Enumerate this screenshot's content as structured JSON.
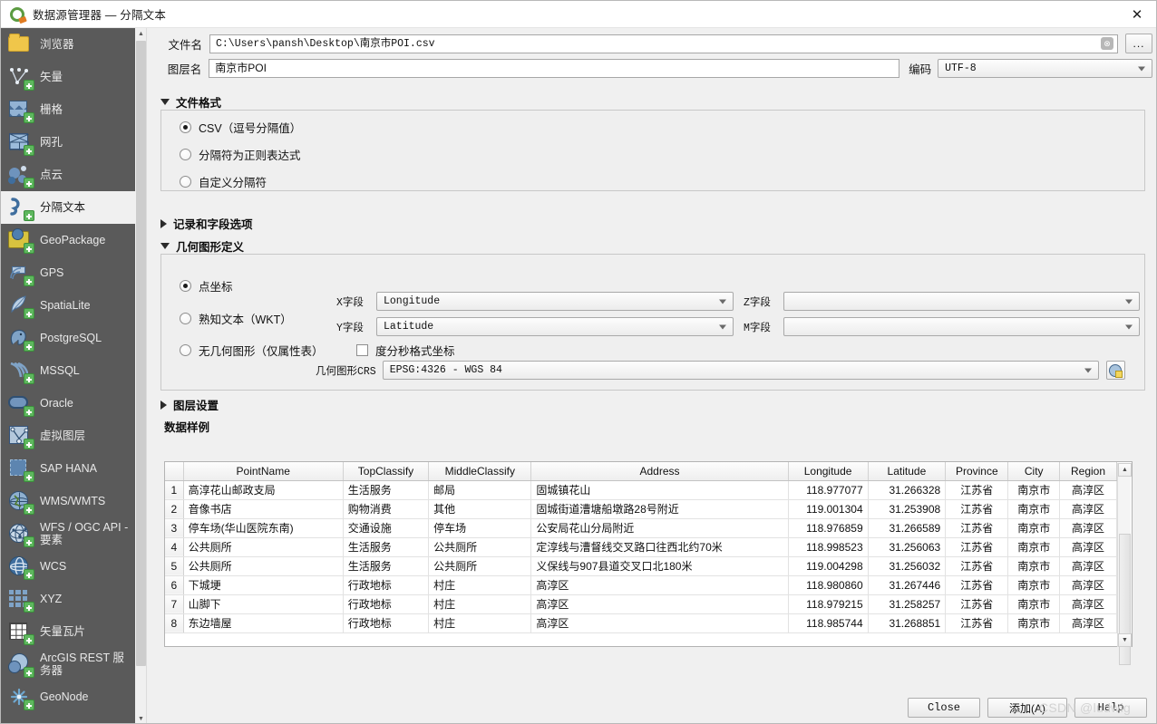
{
  "window": {
    "title": "数据源管理器 — 分隔文本",
    "app_icon": "qgis-logo-icon",
    "close_label": "✕"
  },
  "sidebar": {
    "items": [
      {
        "label": "浏览器",
        "icon": "folder-icon",
        "selected": false
      },
      {
        "label": "矢量",
        "icon": "vector-icon",
        "selected": false
      },
      {
        "label": "栅格",
        "icon": "raster-icon",
        "selected": false
      },
      {
        "label": "网孔",
        "icon": "mesh-icon",
        "selected": false
      },
      {
        "label": "点云",
        "icon": "point-cloud-icon",
        "selected": false
      },
      {
        "label": "分隔文本",
        "icon": "delimited-text-icon",
        "selected": true
      },
      {
        "label": "GeoPackage",
        "icon": "geopackage-icon",
        "selected": false
      },
      {
        "label": "GPS",
        "icon": "gps-icon",
        "selected": false
      },
      {
        "label": "SpatiaLite",
        "icon": "spatialite-icon",
        "selected": false
      },
      {
        "label": "PostgreSQL",
        "icon": "postgresql-icon",
        "selected": false
      },
      {
        "label": "MSSQL",
        "icon": "mssql-icon",
        "selected": false
      },
      {
        "label": "Oracle",
        "icon": "oracle-icon",
        "selected": false
      },
      {
        "label": "虚拟图层",
        "icon": "virtual-layer-icon",
        "selected": false
      },
      {
        "label": "SAP HANA",
        "icon": "sap-hana-icon",
        "selected": false
      },
      {
        "label": "WMS/WMTS",
        "icon": "wms-icon",
        "selected": false
      },
      {
        "label": "WFS / OGC API - 要素",
        "icon": "wfs-icon",
        "selected": false
      },
      {
        "label": "WCS",
        "icon": "wcs-icon",
        "selected": false
      },
      {
        "label": "XYZ",
        "icon": "xyz-icon",
        "selected": false
      },
      {
        "label": "矢量瓦片",
        "icon": "vector-tile-icon",
        "selected": false
      },
      {
        "label": "ArcGIS REST 服务器",
        "icon": "arcgis-rest-icon",
        "selected": false
      },
      {
        "label": "GeoNode",
        "icon": "geonode-icon",
        "selected": false
      }
    ]
  },
  "form": {
    "filename_label": "文件名",
    "filename_value": "C:\\Users\\pansh\\Desktop\\南京市POI.csv",
    "filename_clear": "⊗",
    "browse_label": "...",
    "layername_label": "图层名",
    "layername_value": "南京市POI",
    "encoding_label": "编码",
    "encoding_value": "UTF-8"
  },
  "file_format": {
    "title": "文件格式",
    "expanded": true,
    "options": [
      {
        "label": "CSV（逗号分隔值）",
        "selected": true
      },
      {
        "label": "分隔符为正则表达式",
        "selected": false
      },
      {
        "label": "自定义分隔符",
        "selected": false
      }
    ]
  },
  "record_field_options": {
    "title": "记录和字段选项",
    "expanded": false
  },
  "geometry": {
    "title": "几何图形定义",
    "expanded": true,
    "options": [
      {
        "label": "点坐标",
        "selected": true
      },
      {
        "label": "熟知文本（WKT）",
        "selected": false
      },
      {
        "label": "无几何图形（仅属性表）",
        "selected": false
      }
    ],
    "x_field_label": "X字段",
    "x_field_value": "Longitude",
    "y_field_label": "Y字段",
    "y_field_value": "Latitude",
    "z_field_label": "Z字段",
    "z_field_value": "",
    "m_field_label": "M字段",
    "m_field_value": "",
    "dms_label": "度分秒格式坐标",
    "dms_checked": false,
    "crs_label": "几何图形CRS",
    "crs_value": "EPSG:4326 - WGS 84",
    "crs_select_icon": "crs-picker-icon"
  },
  "layer_settings": {
    "title": "图层设置",
    "expanded": false
  },
  "sample_data": {
    "title": "数据样例",
    "columns": [
      "PointName",
      "TopClassify",
      "MiddleClassify",
      "Address",
      "Longitude",
      "Latitude",
      "Province",
      "City",
      "Region"
    ],
    "rows": [
      {
        "n": "1",
        "cells": [
          "高淳花山邮政支局",
          "生活服务",
          "邮局",
          "固城镇花山",
          "118.977077",
          "31.266328",
          "江苏省",
          "南京市",
          "高淳区"
        ]
      },
      {
        "n": "2",
        "cells": [
          "音像书店",
          "购物消费",
          "其他",
          "固城街道漕塘船墩路28号附近",
          "119.001304",
          "31.253908",
          "江苏省",
          "南京市",
          "高淳区"
        ]
      },
      {
        "n": "3",
        "cells": [
          "停车场(华山医院东南)",
          "交通设施",
          "停车场",
          "公安局花山分局附近",
          "118.976859",
          "31.266589",
          "江苏省",
          "南京市",
          "高淳区"
        ]
      },
      {
        "n": "4",
        "cells": [
          "公共厕所",
          "生活服务",
          "公共厕所",
          "定淳线与漕督线交叉路口往西北约70米",
          "118.998523",
          "31.256063",
          "江苏省",
          "南京市",
          "高淳区"
        ]
      },
      {
        "n": "5",
        "cells": [
          "公共厕所",
          "生活服务",
          "公共厕所",
          "义保线与907县道交叉口北180米",
          "119.004298",
          "31.256032",
          "江苏省",
          "南京市",
          "高淳区"
        ]
      },
      {
        "n": "6",
        "cells": [
          "下城埂",
          "行政地标",
          "村庄",
          "高淳区",
          "118.980860",
          "31.267446",
          "江苏省",
          "南京市",
          "高淳区"
        ]
      },
      {
        "n": "7",
        "cells": [
          "山脚下",
          "行政地标",
          "村庄",
          "高淳区",
          "118.979215",
          "31.258257",
          "江苏省",
          "南京市",
          "高淳区"
        ]
      },
      {
        "n": "8",
        "cells": [
          "东边墙屋",
          "行政地标",
          "村庄",
          "高淳区",
          "118.985744",
          "31.268851",
          "江苏省",
          "南京市",
          "高淳区"
        ]
      }
    ]
  },
  "footer": {
    "close_label": "Close",
    "add_label": "添加(A)",
    "help_label": "Help"
  },
  "watermark": {
    "text": "CSDN @ludwig"
  },
  "colors": {
    "sidebar_bg": "#5a5a5a",
    "selected_bg": "#f0f0f0",
    "panel_bg": "#f0f0f0",
    "accent_green": "#5eb75e"
  }
}
